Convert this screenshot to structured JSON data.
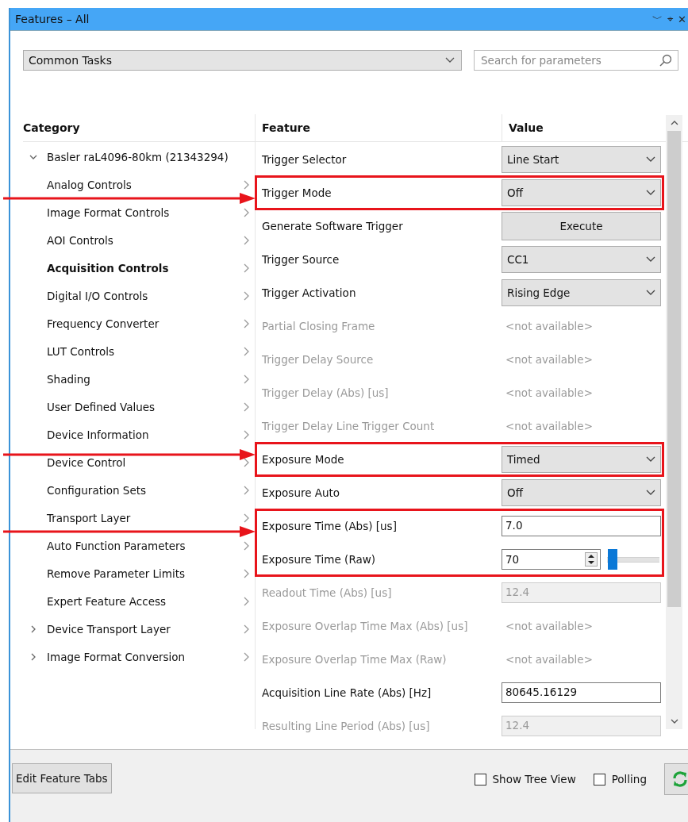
{
  "window": {
    "title": "Features – All",
    "controls": [
      "﹀",
      "⌖",
      "✕"
    ]
  },
  "view_select": {
    "value": "Common Tasks"
  },
  "search": {
    "placeholder": "Search for parameters"
  },
  "columns": {
    "category": "Category",
    "feature": "Feature",
    "value": "Value"
  },
  "categories": [
    {
      "label": "Basler raL4096-80km (21343294)",
      "expanded": true,
      "selected": false,
      "children": [
        {
          "label": "Analog Controls",
          "selected": false
        },
        {
          "label": "Image Format Controls",
          "selected": false
        },
        {
          "label": "AOI Controls",
          "selected": false
        },
        {
          "label": "Acquisition Controls",
          "selected": true
        },
        {
          "label": "Digital I/O Controls",
          "selected": false
        },
        {
          "label": "Frequency Converter",
          "selected": false
        },
        {
          "label": "LUT Controls",
          "selected": false
        },
        {
          "label": "Shading",
          "selected": false
        },
        {
          "label": "User Defined Values",
          "selected": false
        },
        {
          "label": "Device Information",
          "selected": false
        },
        {
          "label": "Device Control",
          "selected": false
        },
        {
          "label": "Configuration Sets",
          "selected": false
        },
        {
          "label": "Transport Layer",
          "selected": false
        },
        {
          "label": "Auto Function Parameters",
          "selected": false
        },
        {
          "label": "Remove Parameter Limits",
          "selected": false
        },
        {
          "label": "Expert Feature Access",
          "selected": false
        }
      ]
    },
    {
      "label": "Device Transport Layer",
      "expanded": false,
      "selected": false
    },
    {
      "label": "Image Format Conversion",
      "expanded": false,
      "selected": false
    }
  ],
  "features": [
    {
      "name": "Trigger Selector",
      "kind": "dropdown",
      "value": "Line Start",
      "available": true,
      "highlighted": false
    },
    {
      "name": "Trigger Mode",
      "kind": "dropdown",
      "value": "Off",
      "available": true,
      "highlighted": true
    },
    {
      "name": "Generate Software Trigger",
      "kind": "button",
      "value": "Execute",
      "available": true,
      "highlighted": false
    },
    {
      "name": "Trigger Source",
      "kind": "dropdown",
      "value": "CC1",
      "available": true,
      "highlighted": false
    },
    {
      "name": "Trigger Activation",
      "kind": "dropdown",
      "value": "Rising Edge",
      "available": true,
      "highlighted": false
    },
    {
      "name": "Partial Closing Frame",
      "kind": "unavailable",
      "value": "<not available>",
      "available": false,
      "highlighted": false
    },
    {
      "name": "Trigger Delay Source",
      "kind": "unavailable",
      "value": "<not available>",
      "available": false,
      "highlighted": false
    },
    {
      "name": "Trigger Delay (Abs) [us]",
      "kind": "unavailable",
      "value": "<not available>",
      "available": false,
      "highlighted": false
    },
    {
      "name": "Trigger Delay Line Trigger Count",
      "kind": "unavailable",
      "value": "<not available>",
      "available": false,
      "highlighted": false
    },
    {
      "name": "Exposure Mode",
      "kind": "dropdown",
      "value": "Timed",
      "available": true,
      "highlighted": true
    },
    {
      "name": "Exposure Auto",
      "kind": "dropdown",
      "value": "Off",
      "available": true,
      "highlighted": false
    },
    {
      "name": "Exposure Time (Abs) [us]",
      "kind": "input",
      "value": "7.0",
      "available": true,
      "highlighted": true
    },
    {
      "name": "Exposure Time (Raw)",
      "kind": "spin-slider",
      "value": "70",
      "level": 0.02,
      "available": true,
      "highlighted": true
    },
    {
      "name": "Readout Time (Abs) [us]",
      "kind": "readonly",
      "value": "12.4",
      "available": false,
      "highlighted": false
    },
    {
      "name": "Exposure Overlap Time Max (Abs) [us]",
      "kind": "unavailable",
      "value": "<not available>",
      "available": false,
      "highlighted": false
    },
    {
      "name": "Exposure Overlap Time Max (Raw)",
      "kind": "unavailable",
      "value": "<not available>",
      "available": false,
      "highlighted": false
    },
    {
      "name": "Acquisition Line Rate (Abs) [Hz]",
      "kind": "input",
      "value": "80645.16129",
      "available": true,
      "highlighted": false
    },
    {
      "name": "Resulting Line Period (Abs) [us]",
      "kind": "readonly",
      "value": "12.4",
      "available": false,
      "highlighted": false
    }
  ],
  "footer": {
    "edit_button": "Edit Feature Tabs",
    "options": [
      {
        "label": "Show Tree View",
        "checked": false
      },
      {
        "label": "Polling",
        "checked": false
      }
    ]
  }
}
